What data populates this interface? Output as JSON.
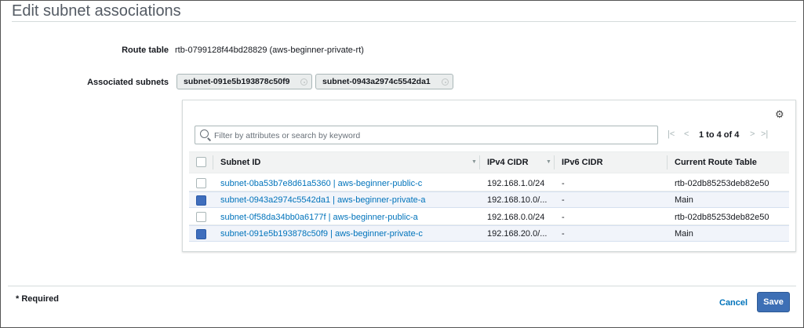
{
  "dialog": {
    "title": "Edit subnet associations"
  },
  "route_table": {
    "label": "Route table",
    "value": "rtb-0799128f44bd28829 (aws-beginner-private-rt)"
  },
  "associated_subnets": {
    "label": "Associated subnets",
    "tokens": [
      "subnet-091e5b193878c50f9",
      "subnet-0943a2974c5542da1"
    ]
  },
  "filter": {
    "placeholder": "Filter by attributes or search by keyword"
  },
  "pager": {
    "first": "|<",
    "prev": "<",
    "text": "1 to 4 of 4",
    "next": ">",
    "last": ">|"
  },
  "table": {
    "columns": [
      "Subnet ID",
      "IPv4 CIDR",
      "IPv6 CIDR",
      "Current Route Table"
    ],
    "rows": [
      {
        "selected": false,
        "subnet": "subnet-0ba53b7e8d61a5360 | aws-beginner-public-c",
        "ipv4": "192.168.1.0/24",
        "ipv6": "-",
        "route_table": "rtb-02db85253deb82e50"
      },
      {
        "selected": true,
        "subnet": "subnet-0943a2974c5542da1 | aws-beginner-private-a",
        "ipv4": "192.168.10.0/...",
        "ipv6": "-",
        "route_table": "Main"
      },
      {
        "selected": false,
        "subnet": "subnet-0f58da34bb0a6177f | aws-beginner-public-a",
        "ipv4": "192.168.0.0/24",
        "ipv6": "-",
        "route_table": "rtb-02db85253deb82e50"
      },
      {
        "selected": true,
        "subnet": "subnet-091e5b193878c50f9 | aws-beginner-private-c",
        "ipv4": "192.168.20.0/...",
        "ipv6": "-",
        "route_table": "Main"
      }
    ]
  },
  "footer": {
    "required": "* Required",
    "cancel": "Cancel",
    "save": "Save"
  },
  "colors": {
    "link": "#0073bb",
    "primary_button": "#3d6fb5",
    "selected_row": "#f1f4fa"
  }
}
